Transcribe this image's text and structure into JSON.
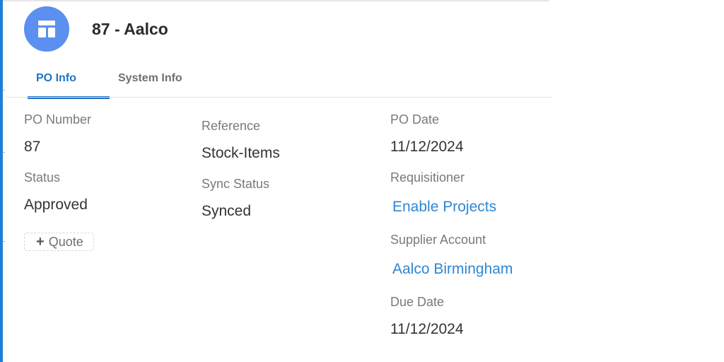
{
  "header": {
    "title": "87 - Aalco",
    "avatar_icon": "layout-icon",
    "avatar_color": "#5b8ff0"
  },
  "tabs": [
    {
      "label": "PO Info",
      "active": true
    },
    {
      "label": "System Info",
      "active": false
    }
  ],
  "fields": {
    "po_number": {
      "label": "PO Number",
      "value": "87"
    },
    "status": {
      "label": "Status",
      "value": "Approved"
    },
    "reference": {
      "label": "Reference",
      "value": "Stock-Items"
    },
    "sync_status": {
      "label": "Sync Status",
      "value": "Synced"
    },
    "po_date": {
      "label": "PO Date",
      "value": "11/12/2024"
    },
    "requisitioner": {
      "label": "Requisitioner",
      "value": "Enable Projects"
    },
    "supplier_account": {
      "label": "Supplier Account",
      "value": "Aalco Birmingham"
    },
    "due_date": {
      "label": "Due Date",
      "value": "11/12/2024"
    }
  },
  "actions": {
    "quote_label": "Quote",
    "quote_icon": "plus-icon"
  },
  "colors": {
    "accent": "#1f73c7",
    "link": "#2f86d4",
    "rail": "#1f7fd8"
  }
}
